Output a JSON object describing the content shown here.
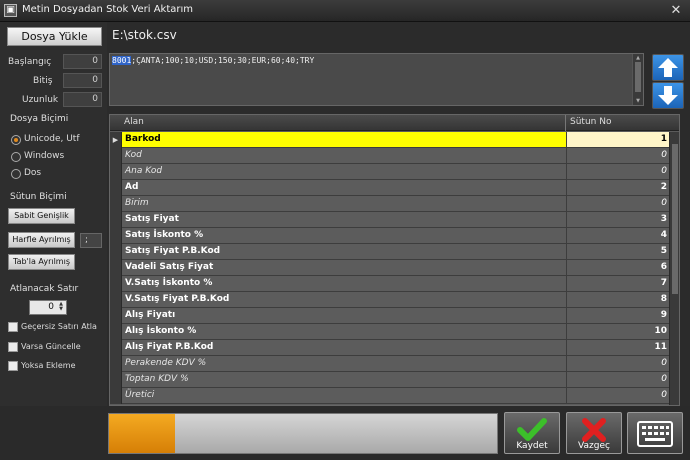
{
  "window": {
    "title": "Metin Dosyadan Stok Veri Aktarım",
    "app_icon": "window-icon",
    "close_glyph": "✕"
  },
  "file": {
    "load_label": "Dosya Yükle",
    "path": "E:\\stok.csv"
  },
  "range": {
    "start_label": "Başlangıç",
    "start_value": "0",
    "end_label": "Bitiş",
    "end_value": "0",
    "length_label": "Uzunluk",
    "length_value": "0"
  },
  "format": {
    "title": "Dosya Biçimi",
    "options": [
      {
        "label": "Unicode, Utf",
        "selected": true
      },
      {
        "label": "Windows",
        "selected": false
      },
      {
        "label": "Dos",
        "selected": false
      }
    ]
  },
  "column_format": {
    "title": "Sütun Biçimi",
    "fixed_width_label": "Sabit Genişlik",
    "char_separated_label": "Harfle Ayrılmış",
    "separator_value": ";",
    "tab_separated_label": "Tab'la Ayrılmış"
  },
  "skip": {
    "title": "Atlanacak Satır",
    "value": "0"
  },
  "options": {
    "skip_invalid_label": "Geçersiz Satırı Atla",
    "update_if_exists_label": "Varsa Güncelle",
    "add_if_missing_label": "Yoksa Ekleme"
  },
  "preview": {
    "selected_text": "8001",
    "rest_text": ";ÇANTA;100;10;USD;150;30;EUR;60;40;TRY"
  },
  "grid": {
    "headers": {
      "alan": "Alan",
      "sutun": "Sütun No"
    },
    "rows": [
      {
        "alan": "Barkod",
        "sutun": "1",
        "italic": false,
        "active": true
      },
      {
        "alan": "Kod",
        "sutun": "0",
        "italic": true,
        "active": false
      },
      {
        "alan": "Ana Kod",
        "sutun": "0",
        "italic": true,
        "active": false
      },
      {
        "alan": "Ad",
        "sutun": "2",
        "italic": false,
        "active": false
      },
      {
        "alan": "Birim",
        "sutun": "0",
        "italic": true,
        "active": false
      },
      {
        "alan": "Satış Fiyat",
        "sutun": "3",
        "italic": false,
        "active": false
      },
      {
        "alan": "Satış İskonto %",
        "sutun": "4",
        "italic": false,
        "active": false
      },
      {
        "alan": "Satış Fiyat P.B.Kod",
        "sutun": "5",
        "italic": false,
        "active": false
      },
      {
        "alan": "Vadeli Satış Fiyat",
        "sutun": "6",
        "italic": false,
        "active": false
      },
      {
        "alan": "V.Satış İskonto %",
        "sutun": "7",
        "italic": false,
        "active": false
      },
      {
        "alan": "V.Satış Fiyat P.B.Kod",
        "sutun": "8",
        "italic": false,
        "active": false
      },
      {
        "alan": "Alış Fiyatı",
        "sutun": "9",
        "italic": false,
        "active": false
      },
      {
        "alan": "Alış İskonto %",
        "sutun": "10",
        "italic": false,
        "active": false
      },
      {
        "alan": "Alış Fiyat P.B.Kod",
        "sutun": "11",
        "italic": false,
        "active": false
      },
      {
        "alan": "Perakende KDV %",
        "sutun": "0",
        "italic": true,
        "active": false
      },
      {
        "alan": "Toptan KDV %",
        "sutun": "0",
        "italic": true,
        "active": false
      },
      {
        "alan": "Üretici",
        "sutun": "0",
        "italic": true,
        "active": false
      }
    ]
  },
  "progress": {
    "value": 0.17
  },
  "actions": {
    "save_label": "Kaydet",
    "cancel_label": "Vazgeç"
  },
  "colors": {
    "active_row": "#ffff00",
    "progress": "#f0a020",
    "arrow_blue": "#2a7fd6",
    "save_green": "#3cbf2a",
    "cancel_red": "#e02020"
  }
}
